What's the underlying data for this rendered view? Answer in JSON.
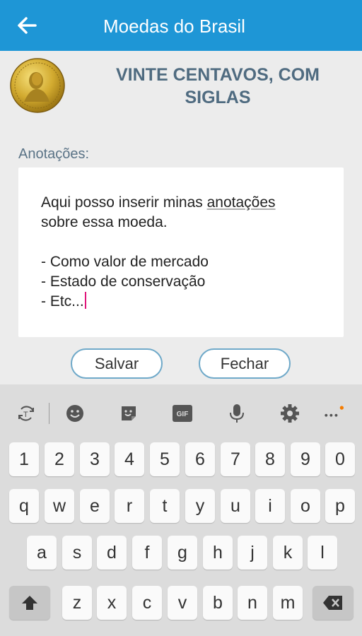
{
  "app_bar": {
    "title": "Moedas do Brasil",
    "back_icon": "arrow-left-icon",
    "color": "#1e96d6"
  },
  "coin": {
    "name_line1": "VINTE CENTAVOS, COM",
    "name_line2": "SIGLAS",
    "image_icon": "coin-image"
  },
  "notes": {
    "label": "Anotações:",
    "line1_pre": "Aqui posso inserir minas ",
    "line1_word": "anotações",
    "line2": "sobre essa moeda.",
    "line3": "- Como valor de mercado",
    "line4": "- Estado de conservação",
    "line5": "- Etc..."
  },
  "buttons": {
    "save": "Salvar",
    "close": "Fechar"
  },
  "keyboard": {
    "toolbar": [
      "translate-icon",
      "emoji-icon",
      "sticker-icon",
      "gif-icon",
      "mic-icon",
      "settings-icon",
      "more-icon"
    ],
    "gif_label": "GIF",
    "row_numbers": [
      "1",
      "2",
      "3",
      "4",
      "5",
      "6",
      "7",
      "8",
      "9",
      "0"
    ],
    "row1": [
      "q",
      "w",
      "e",
      "r",
      "t",
      "y",
      "u",
      "i",
      "o",
      "p"
    ],
    "row2": [
      "a",
      "s",
      "d",
      "f",
      "g",
      "h",
      "j",
      "k",
      "l"
    ],
    "row3": [
      "z",
      "x",
      "c",
      "v",
      "b",
      "n",
      "m"
    ],
    "shift_icon": "shift-icon",
    "backspace_icon": "backspace-icon",
    "accent": "#f57c00"
  }
}
